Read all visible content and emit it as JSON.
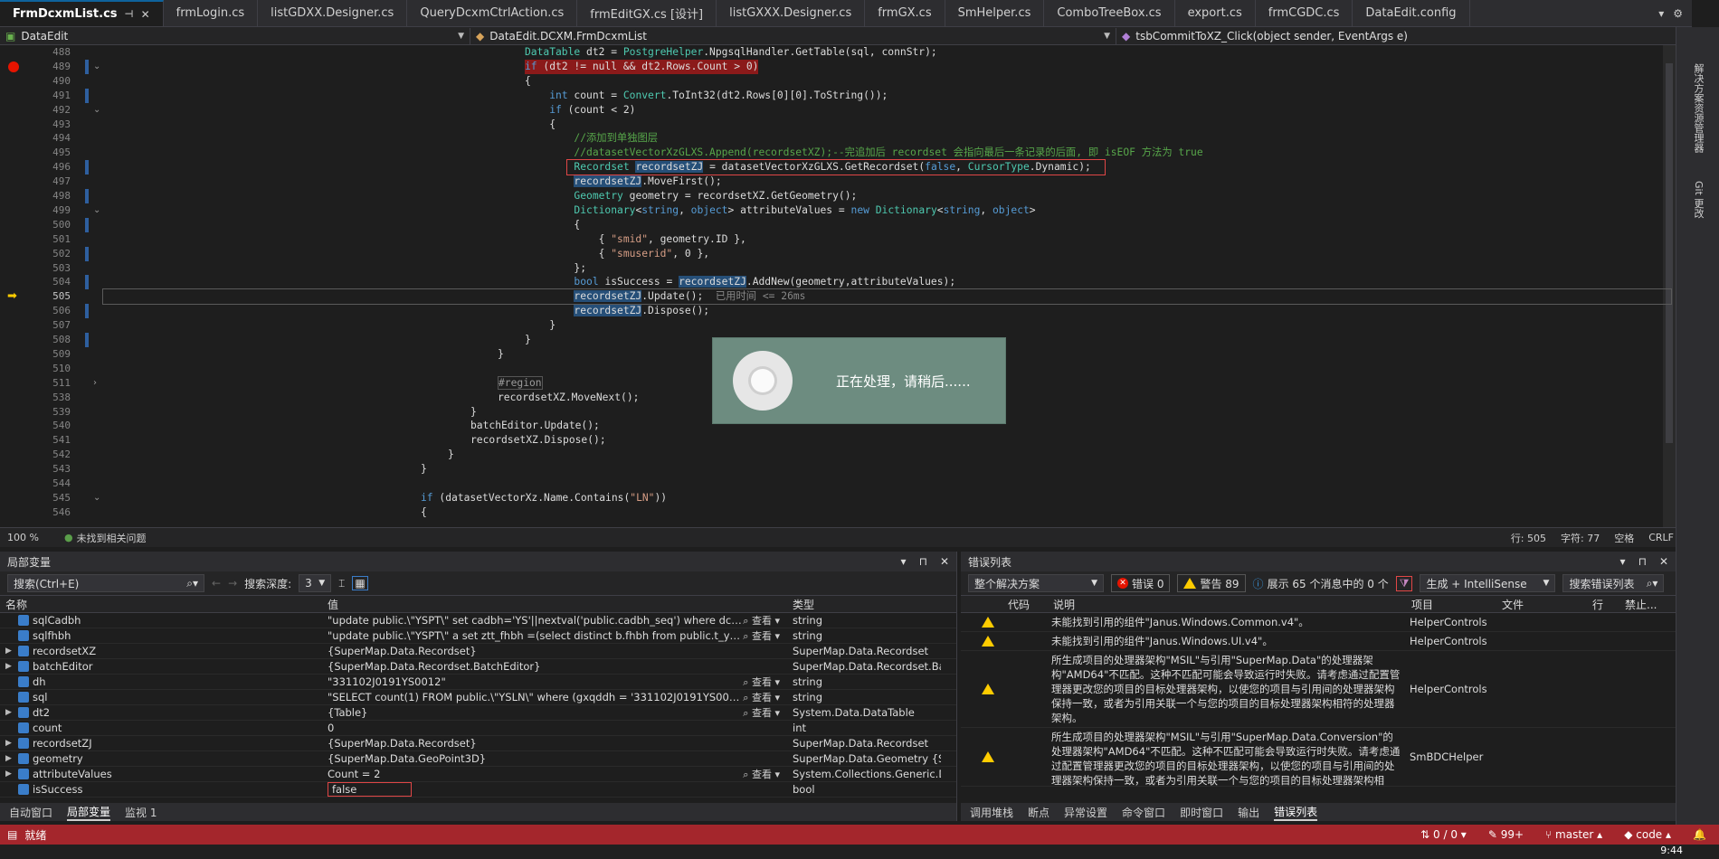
{
  "tabs": [
    {
      "label": "FrmDcxmList.cs",
      "active": true
    },
    {
      "label": "frmLogin.cs"
    },
    {
      "label": "listGDXX.Designer.cs"
    },
    {
      "label": "QueryDcxmCtrlAction.cs"
    },
    {
      "label": "frmEditGX.cs [设计]"
    },
    {
      "label": "listGXXX.Designer.cs"
    },
    {
      "label": "frmGX.cs"
    },
    {
      "label": "SmHelper.cs"
    },
    {
      "label": "ComboTreeBox.cs"
    },
    {
      "label": "export.cs"
    },
    {
      "label": "frmCGDC.cs"
    },
    {
      "label": "DataEdit.config"
    }
  ],
  "navbar": {
    "project": "DataEdit",
    "type": "DataEdit.DCXM.FrmDcxmList",
    "member": "tsbCommitToXZ_Click(object sender, EventArgs e)"
  },
  "code_lines": [
    {
      "n": "488",
      "html": "DataTable dt2 = PostgreHelper.NpgsqlHandler.GetTable(sql, connStr);"
    },
    {
      "n": "489",
      "html": "if (dt2 != null && dt2.Rows.Count > 0)"
    },
    {
      "n": "490",
      "html": "{"
    },
    {
      "n": "491",
      "html": "    int count = Convert.ToInt32(dt2.Rows[0][0].ToString());"
    },
    {
      "n": "492",
      "html": "    if (count < 2)"
    },
    {
      "n": "493",
      "html": "    {"
    },
    {
      "n": "494",
      "html": "        //添加到单独图层"
    },
    {
      "n": "495",
      "html": "        //datasetVectorXzGLXS.Append(recordsetXZ);--完追加后 recordset 会指向最后一条记录的后面, 即 isEOF 方法为 true"
    },
    {
      "n": "496",
      "html": "        Recordset recordsetZJ = datasetVectorXzGLXS.GetRecordset(false, CursorType.Dynamic);"
    },
    {
      "n": "497",
      "html": "        recordsetZJ.MoveFirst();"
    },
    {
      "n": "498",
      "html": "        Geometry geometry = recordsetXZ.GetGeometry();"
    },
    {
      "n": "499",
      "html": "        Dictionary<string, object> attributeValues = new Dictionary<string, object>"
    },
    {
      "n": "500",
      "html": "        {"
    },
    {
      "n": "501",
      "html": "            { \"smid\", geometry.ID },"
    },
    {
      "n": "502",
      "html": "            { \"smuserid\", 0 },"
    },
    {
      "n": "503",
      "html": "        };"
    },
    {
      "n": "504",
      "html": "        bool isSuccess = recordsetZJ.AddNew(geometry,attributeValues);"
    },
    {
      "n": "505",
      "html": "        recordsetZJ.Update();  已用时间 <= 26ms"
    },
    {
      "n": "506",
      "html": "        recordsetZJ.Dispose();"
    },
    {
      "n": "507",
      "html": "    }"
    },
    {
      "n": "508",
      "html": "}"
    },
    {
      "n": "509",
      "html": "}"
    },
    {
      "n": "510",
      "html": ""
    },
    {
      "n": "511",
      "html": "#region"
    },
    {
      "n": "538",
      "html": "recordsetXZ.MoveNext();"
    },
    {
      "n": "539",
      "html": "}"
    },
    {
      "n": "540",
      "html": "batchEditor.Update();"
    },
    {
      "n": "541",
      "html": "recordsetXZ.Dispose();"
    },
    {
      "n": "542",
      "html": "}"
    },
    {
      "n": "543",
      "html": "}"
    },
    {
      "n": "544",
      "html": ""
    },
    {
      "n": "545",
      "html": "if (datasetVectorXz.Name.Contains(\"LN\"))"
    },
    {
      "n": "546",
      "html": "{"
    }
  ],
  "dialog": {
    "message": "正在处理，请稍后......"
  },
  "editor_status": {
    "zoom": "100 %",
    "issues": "未找到相关问题",
    "line": "行: 505",
    "char": "字符: 77",
    "space": "空格",
    "eol": "CRLF"
  },
  "locals": {
    "title": "局部变量",
    "search_placeholder": "搜索(Ctrl+E)",
    "depth_label": "搜索深度:",
    "depth_value": "3",
    "columns": [
      "名称",
      "值",
      "类型"
    ],
    "view_label": "查看",
    "rows": [
      {
        "name": "sqlCadbh",
        "value": "\"update public.\\\"YSPT\\\"  set cadbh='YS'||nextval('public.cadbh_seq') where dcxmid...",
        "type": "string",
        "view": true
      },
      {
        "name": "sqlfhbh",
        "value": "\"update public.\\\"YSPT\\\" a set ztt_fhbh =(select distinct b.fhbh  from public.t_ysdm b...",
        "type": "string",
        "view": true
      },
      {
        "name": "recordsetXZ",
        "value": "{SuperMap.Data.Recordset}",
        "type": "SuperMap.Data.Recordset",
        "exp": true
      },
      {
        "name": "batchEditor",
        "value": "{SuperMap.Data.Recordset.BatchEditor}",
        "type": "SuperMap.Data.Recordset.Bat...",
        "exp": true
      },
      {
        "name": "dh",
        "value": "\"331102J0191YS0012\"",
        "type": "string",
        "view": true
      },
      {
        "name": "sql",
        "value": "\"SELECT count(1) FROM public.\\\"YSLN\\\"  where (gxqddh = '331102J0191YS0012' or ...",
        "type": "string",
        "view": true
      },
      {
        "name": "dt2",
        "value": "{Table}",
        "type": "System.Data.DataTable",
        "exp": true,
        "view": true
      },
      {
        "name": "count",
        "value": "0",
        "type": "int"
      },
      {
        "name": "recordsetZJ",
        "value": "{SuperMap.Data.Recordset}",
        "type": "SuperMap.Data.Recordset",
        "exp": true
      },
      {
        "name": "geometry",
        "value": "{SuperMap.Data.GeoPoint3D}",
        "type": "SuperMap.Data.Geometry {Su...",
        "exp": true
      },
      {
        "name": "attributeValues",
        "value": "Count = 2",
        "type": "System.Collections.Generic.Di...",
        "exp": true,
        "view": true
      },
      {
        "name": "isSuccess",
        "value": "false",
        "type": "bool",
        "boxed": true
      }
    ],
    "footer_tabs": [
      "自动窗口",
      "局部变量",
      "监视 1"
    ]
  },
  "errors": {
    "title": "错误列表",
    "scope": "整个解决方案",
    "errors_count": "错误 0",
    "warnings_count": "警告 89",
    "messages": "展示 65 个消息中的 0 个",
    "build_filter": "生成 + IntelliSense",
    "search_placeholder": "搜索错误列表",
    "columns": [
      "代码",
      "说明",
      "项目",
      "文件",
      "行",
      "禁止..."
    ],
    "rows": [
      {
        "desc": "未能找到引用的组件\"Janus.Windows.Common.v4\"。",
        "project": "HelperControls"
      },
      {
        "desc": "未能找到引用的组件\"Janus.Windows.UI.v4\"。",
        "project": "HelperControls"
      },
      {
        "desc": "所生成项目的处理器架构\"MSIL\"与引用\"SuperMap.Data\"的处理器架构\"AMD64\"不匹配。这种不匹配可能会导致运行时失败。请考虑通过配置管理器更改您的项目的目标处理器架构，以使您的项目与引用间的处理器架构保持一致，或者为引用关联一个与您的项目的目标处理器架构相符的处理器架构。",
        "project": "HelperControls"
      },
      {
        "desc": "所生成项目的处理器架构\"MSIL\"与引用\"SuperMap.Data.Conversion\"的处理器架构\"AMD64\"不匹配。这种不匹配可能会导致运行时失败。请考虑通过配置管理器更改您的项目的目标处理器架构，以使您的项目与引用间的处理器架构保持一致，或者为引用关联一个与您的项目的目标处理器架构相",
        "project": "SmBDCHelper"
      }
    ],
    "footer_tabs": [
      "调用堆栈",
      "断点",
      "异常设置",
      "命令窗口",
      "即时窗口",
      "输出",
      "错误列表"
    ]
  },
  "sidebar": {
    "item1": "解决方案资源管理器",
    "item2": "Git 更改"
  },
  "statusbar": {
    "ready": "就绪",
    "lines": "0 / 0",
    "changes": "99+",
    "branch": "master",
    "repo": "code"
  },
  "taskbar": {
    "time": "9:44"
  }
}
